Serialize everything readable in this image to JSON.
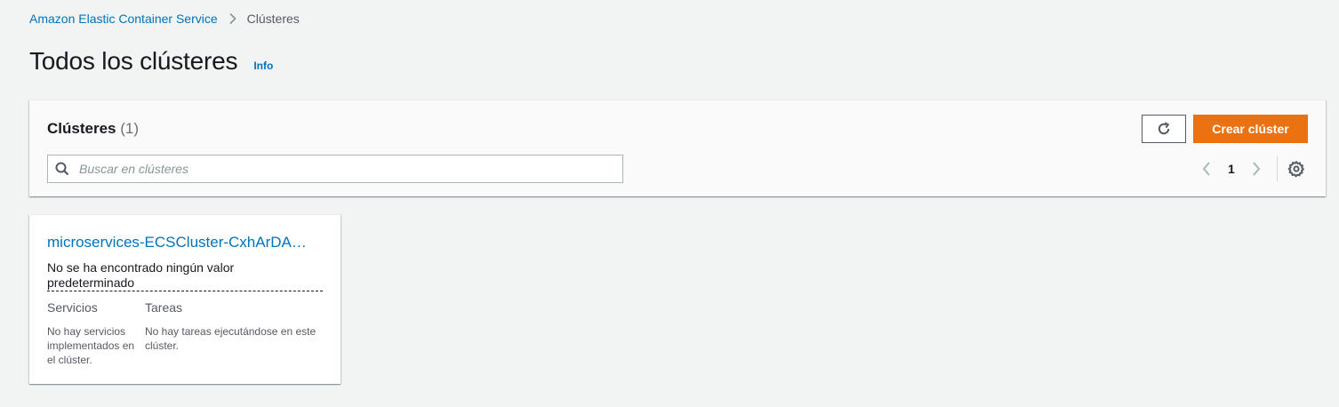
{
  "breadcrumb": {
    "service": "Amazon Elastic Container Service",
    "current": "Clústeres"
  },
  "header": {
    "title": "Todos los clústeres",
    "info": "Info"
  },
  "clusters_panel": {
    "title": "Clústeres",
    "count": "(1)",
    "refresh_icon": "refresh-icon",
    "create_label": "Crear clúster",
    "search_placeholder": "Buscar en clústeres",
    "search_value": "",
    "page": "1",
    "accent_color": "#ec7211"
  },
  "cluster_card": {
    "name": "microservices-ECSCluster-CxhArDA…",
    "description": "No se ha encontrado ningún valor predeterminado",
    "services_label": "Servicios",
    "services_value": "No hay servicios implementados en el clúster.",
    "tasks_label": "Tareas",
    "tasks_value": "No hay tareas ejecutándose en este clúster.",
    "link_color": "#0073bb"
  }
}
